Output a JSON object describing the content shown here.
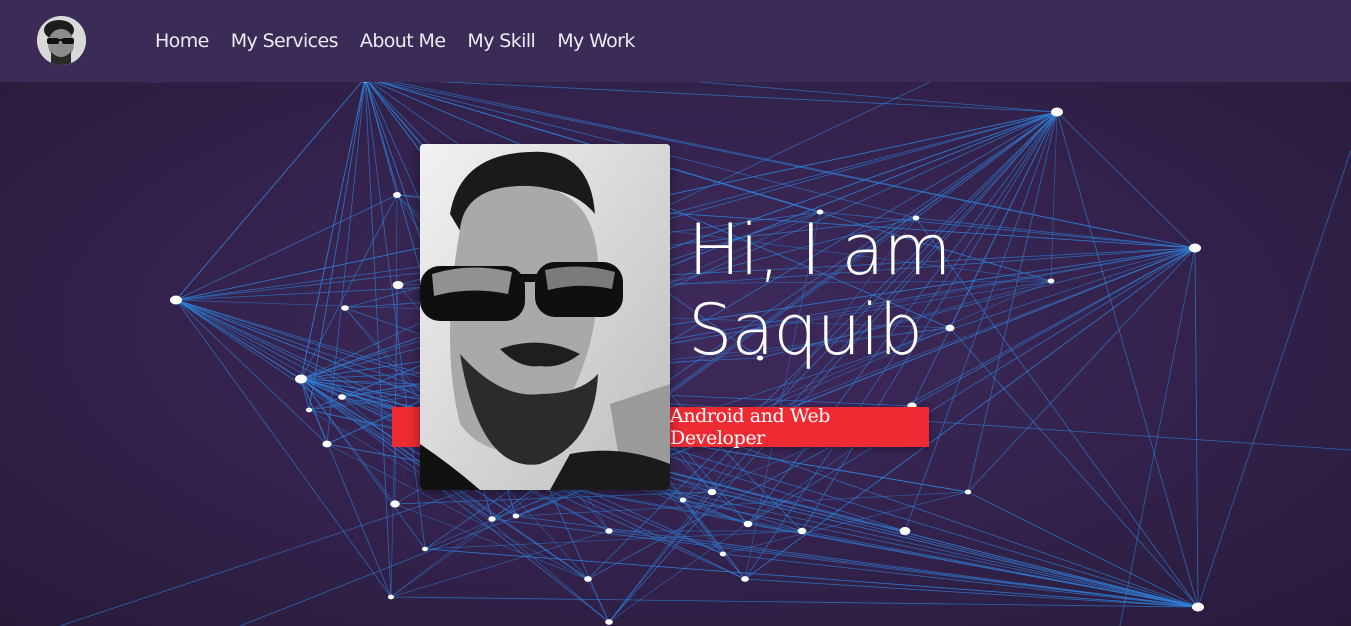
{
  "nav": {
    "avatar_icon": "profile-photo-avatar",
    "links": [
      "Home",
      "My Services",
      "About Me",
      "My Skill",
      "My Work"
    ]
  },
  "hero": {
    "greeting_line1": "Hi, I am",
    "greeting_line2": "Saquib",
    "role": "Android and Web Developer",
    "photo_icon": "profile-portrait-photo"
  },
  "colors": {
    "nav_bg": "#3a2b57",
    "hero_bg": "#33224c",
    "accent_red": "#ee2a32",
    "network_line": "#2f7fd6",
    "network_node": "#ffffff"
  }
}
